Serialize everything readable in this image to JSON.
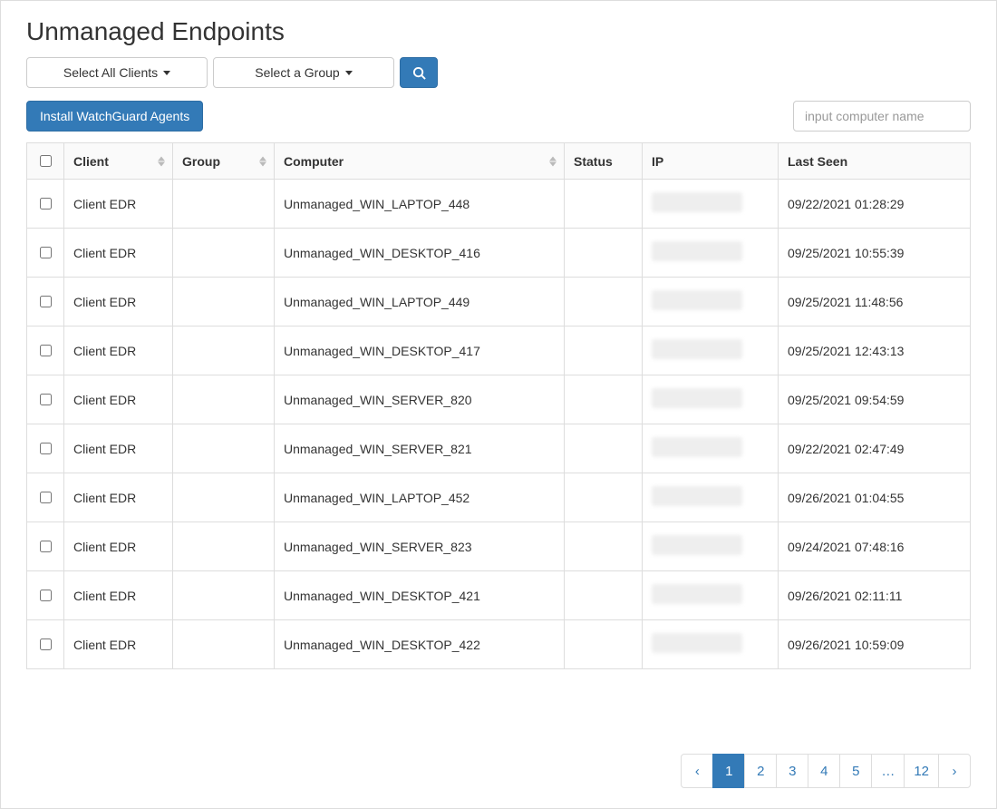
{
  "title": "Unmanaged Endpoints",
  "toolbar": {
    "select_clients_label": "Select All Clients",
    "select_group_label": "Select a Group",
    "install_label": "Install WatchGuard Agents",
    "filter_placeholder": "input computer name"
  },
  "columns": {
    "client": "Client",
    "group": "Group",
    "computer": "Computer",
    "status": "Status",
    "ip": "IP",
    "last_seen": "Last Seen"
  },
  "rows": [
    {
      "client": "Client EDR",
      "group": "",
      "computer": "Unmanaged_WIN_LAPTOP_448",
      "status": "",
      "last_seen": "09/22/2021 01:28:29"
    },
    {
      "client": "Client EDR",
      "group": "",
      "computer": "Unmanaged_WIN_DESKTOP_416",
      "status": "",
      "last_seen": "09/25/2021 10:55:39"
    },
    {
      "client": "Client EDR",
      "group": "",
      "computer": "Unmanaged_WIN_LAPTOP_449",
      "status": "",
      "last_seen": "09/25/2021 11:48:56"
    },
    {
      "client": "Client EDR",
      "group": "",
      "computer": "Unmanaged_WIN_DESKTOP_417",
      "status": "",
      "last_seen": "09/25/2021 12:43:13"
    },
    {
      "client": "Client EDR",
      "group": "",
      "computer": "Unmanaged_WIN_SERVER_820",
      "status": "",
      "last_seen": "09/25/2021 09:54:59"
    },
    {
      "client": "Client EDR",
      "group": "",
      "computer": "Unmanaged_WIN_SERVER_821",
      "status": "",
      "last_seen": "09/22/2021 02:47:49"
    },
    {
      "client": "Client EDR",
      "group": "",
      "computer": "Unmanaged_WIN_LAPTOP_452",
      "status": "",
      "last_seen": "09/26/2021 01:04:55"
    },
    {
      "client": "Client EDR",
      "group": "",
      "computer": "Unmanaged_WIN_SERVER_823",
      "status": "",
      "last_seen": "09/24/2021 07:48:16"
    },
    {
      "client": "Client EDR",
      "group": "",
      "computer": "Unmanaged_WIN_DESKTOP_421",
      "status": "",
      "last_seen": "09/26/2021 02:11:11"
    },
    {
      "client": "Client EDR",
      "group": "",
      "computer": "Unmanaged_WIN_DESKTOP_422",
      "status": "",
      "last_seen": "09/26/2021 10:59:09"
    }
  ],
  "pagination": {
    "prev": "‹",
    "pages": [
      "1",
      "2",
      "3",
      "4",
      "5",
      "…",
      "12"
    ],
    "active_index": 0,
    "next": "›"
  }
}
